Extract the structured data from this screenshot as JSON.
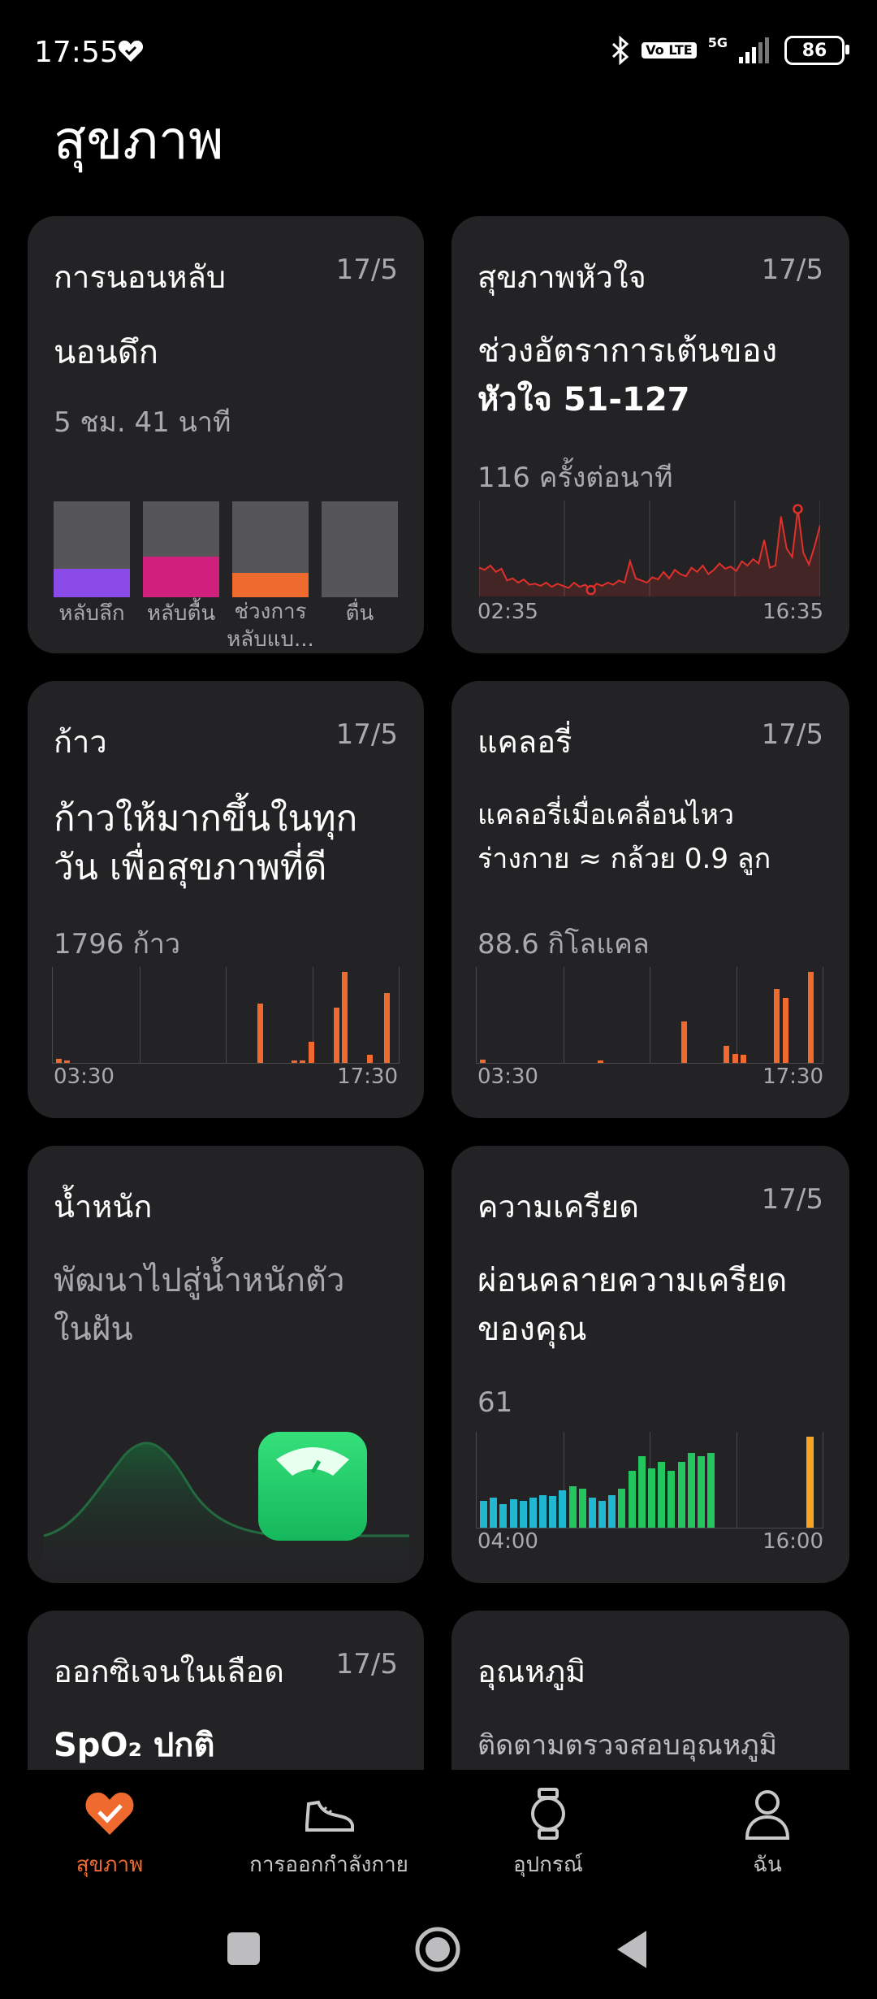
{
  "status_bar": {
    "time": "17:55",
    "network_badge": "Vo LTE",
    "signal_label": "5G",
    "battery": "86"
  },
  "page": {
    "title": "สุขภาพ"
  },
  "cards": {
    "sleep": {
      "title": "การนอนหลับ",
      "date": "17/5",
      "headline": "นอนดึก",
      "duration": "5 ชม. 41 นาที",
      "stages": [
        {
          "label": "หลับลึก",
          "fraction": 0.3,
          "color": "#8a4ae8"
        },
        {
          "label": "หลับตื้น",
          "fraction": 0.42,
          "color": "#d01f7c"
        },
        {
          "label": "ช่วงการ\nหลับแบ...",
          "fraction": 0.25,
          "color": "#ee6a2e"
        },
        {
          "label": "ตื่น",
          "fraction": 0,
          "color": "#565658"
        }
      ]
    },
    "heart": {
      "title": "สุขภาพหัวใจ",
      "date": "17/5",
      "headline_line1": "ช่วงอัตราการเต้นของ",
      "headline_line2": "หัวใจ 51-127",
      "reading": "116 ครั้งต่อนาที",
      "x_start": "02:35",
      "x_end": "16:35"
    },
    "steps": {
      "title": "ก้าว",
      "date": "17/5",
      "headline_line1": "ก้าวให้มากขึ้นในทุก",
      "headline_line2": "วัน เพื่อสุขภาพที่ดี",
      "reading": "1796 ก้าว",
      "x_start": "03:30",
      "x_end": "17:30"
    },
    "calories": {
      "title": "แคลอรี่",
      "date": "17/5",
      "headline_line1": "แคลอรี่เมื่อเคลื่อนไหว",
      "headline_line2": "ร่างกาย ≈ กล้วย 0.9 ลูก",
      "reading": "88.6 กิโลแคล",
      "x_start": "03:30",
      "x_end": "17:30"
    },
    "weight": {
      "title": "น้ำหนัก",
      "headline_line1": "พัฒนาไปสู่น้ำหนักตัว",
      "headline_line2": "ในฝัน"
    },
    "stress": {
      "title": "ความเครียด",
      "date": "17/5",
      "headline_line1": "ผ่อนคลายความเครียด",
      "headline_line2": "ของคุณ",
      "reading": "61",
      "x_start": "04:00",
      "x_end": "16:00"
    },
    "spo2": {
      "title": "ออกซิเจนในเลือด",
      "date": "17/5",
      "headline": "SpO₂ ปกติ"
    },
    "temperature": {
      "title": "อุณหภูมิ",
      "headline": "ติดตามตรวจสอบอุณหภูมิ"
    }
  },
  "bottom_nav": [
    {
      "label": "สุขภาพ",
      "icon": "heart-icon",
      "active": true
    },
    {
      "label": "การออกกำลังกาย",
      "icon": "shoe-icon",
      "active": false
    },
    {
      "label": "อุปกรณ์",
      "icon": "watch-icon",
      "active": false
    },
    {
      "label": "ฉัน",
      "icon": "person-icon",
      "active": false
    }
  ],
  "colors": {
    "accent": "#ee6a2e",
    "card": "#232325",
    "heart_line": "#e0302a",
    "stress_low": "#1fb8d0",
    "stress_mid": "#22c55e",
    "stress_high": "#f5a623"
  },
  "chart_data": [
    {
      "type": "line",
      "title": "สุขภาพหัวใจ",
      "x_labels": [
        "02:35",
        "16:35"
      ],
      "ylabel": "",
      "ylim": [
        45,
        135
      ],
      "series": [
        {
          "values": [
            72,
            70,
            74,
            68,
            71,
            60,
            62,
            58,
            61,
            56,
            57,
            55,
            58,
            54,
            57,
            55,
            53,
            58,
            54,
            56,
            51,
            57,
            55,
            58,
            56,
            60,
            58,
            78,
            62,
            60,
            58,
            63,
            61,
            68,
            62,
            70,
            66,
            64,
            72,
            68,
            74,
            66,
            70,
            76,
            71,
            73,
            69,
            78,
            74,
            80,
            76,
            98,
            72,
            74,
            120,
            90,
            82,
            127,
            86,
            75,
            92,
            112
          ]
        }
      ]
    },
    {
      "type": "bar",
      "title": "ก้าว",
      "x_labels": [
        "03:30",
        "17:30"
      ],
      "categories_count": 40,
      "values": [
        40,
        10,
        0,
        0,
        0,
        0,
        0,
        0,
        0,
        0,
        0,
        0,
        0,
        0,
        0,
        0,
        0,
        0,
        0,
        0,
        0,
        0,
        0,
        0,
        560,
        0,
        0,
        0,
        10,
        10,
        200,
        0,
        0,
        520,
        860,
        0,
        0,
        80,
        0,
        660
      ]
    },
    {
      "type": "bar",
      "title": "แคลอรี่",
      "x_labels": [
        "03:30",
        "17:30"
      ],
      "categories_count": 40,
      "values": [
        0.3,
        0,
        0,
        0,
        0,
        0,
        0,
        0,
        0,
        0,
        0,
        0,
        0,
        0,
        0.1,
        0,
        0,
        0,
        0,
        0,
        0,
        0,
        0,
        0,
        4.1,
        0,
        0,
        0,
        0,
        1.7,
        0.9,
        0.8,
        0,
        0,
        0,
        7.3,
        6.4,
        0,
        0,
        9.0
      ]
    },
    {
      "type": "bar",
      "title": "ความเครียด",
      "x_labels": [
        "04:00",
        "16:00"
      ],
      "categories_count": 34,
      "values": [
        18,
        20,
        16,
        19,
        18,
        20,
        22,
        21,
        25,
        28,
        26,
        20,
        18,
        22,
        26,
        38,
        48,
        40,
        44,
        38,
        44,
        50,
        48,
        50,
        0,
        0,
        0,
        0,
        0,
        0,
        0,
        0,
        0,
        61
      ]
    }
  ]
}
